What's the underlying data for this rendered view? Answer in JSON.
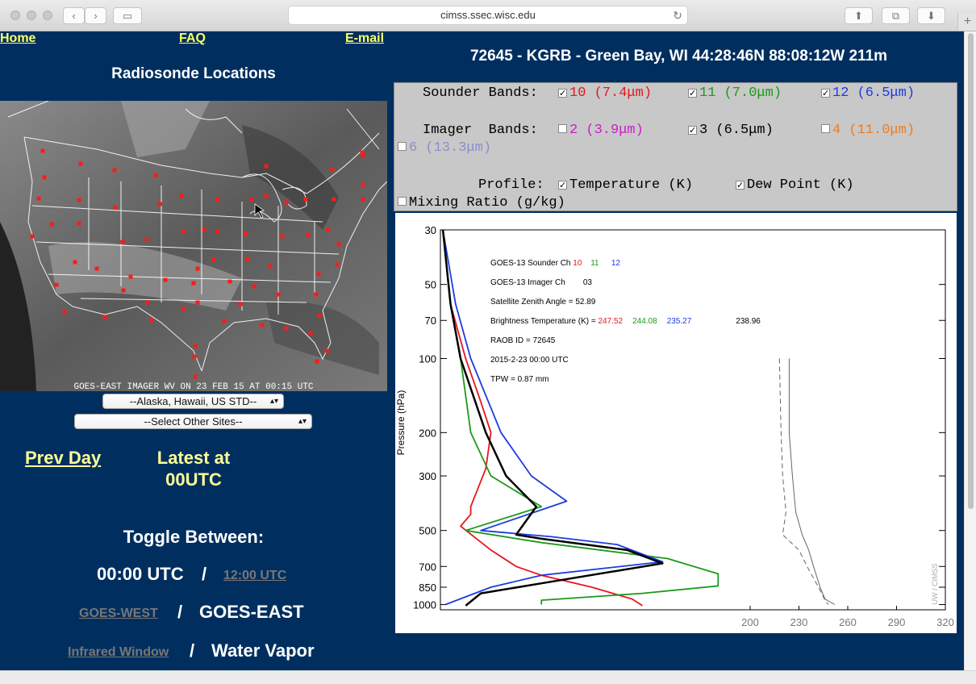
{
  "browser": {
    "url": "cimss.ssec.wisc.edu"
  },
  "nav": {
    "home": "Home",
    "faq": "FAQ",
    "email": "E-mail"
  },
  "left": {
    "title": "Radiosonde Locations",
    "map_caption": "GOES-EAST IMAGER WV ON 23 FEB 15 AT 00:15 UTC",
    "select1": "--Alaska, Hawaii, US STD--",
    "select2": "--Select Other Sites--",
    "prev_day": "Prev Day",
    "latest": "Latest at",
    "latest2": "00UTC",
    "toggle": "Toggle Between:",
    "utc_active": "00:00 UTC",
    "utc_other": "12:00 UTC",
    "sat_other": "GOES-WEST",
    "sat_active": "GOES-EAST",
    "band_other": "Infrared Window",
    "band_active": "Water Vapor",
    "slash": "/"
  },
  "station": {
    "title": "72645 - KGRB - Green Bay, WI 44:28:46N 88:08:12W 211m"
  },
  "options": {
    "sounder_label": "Sounder Bands:",
    "imager_label": "Imager  Bands:",
    "profile_label": "Profile:",
    "sounder": [
      {
        "num": "10",
        "wl": "(7.4μm)",
        "checked": true,
        "color": "#e8151d"
      },
      {
        "num": "11",
        "wl": "(7.0μm)",
        "checked": true,
        "color": "#1b9a1b"
      },
      {
        "num": "12",
        "wl": "(6.5μm)",
        "checked": true,
        "color": "#1c3ce0"
      }
    ],
    "imager": [
      {
        "num": "2",
        "wl": "(3.9μm)",
        "checked": false,
        "color": "#c81ec8"
      },
      {
        "num": "3",
        "wl": "(6.5μm)",
        "checked": true,
        "color": "#000000"
      },
      {
        "num": "4",
        "wl": "(11.0μm)",
        "checked": false,
        "color": "#f07b1e"
      },
      {
        "num": "6",
        "wl": "(13.3μm)",
        "checked": false,
        "color": "#8a8fc8"
      }
    ],
    "profiles": [
      {
        "label": "Temperature (K)",
        "checked": true
      },
      {
        "label": "Dew Point (K)",
        "checked": true
      },
      {
        "label": "Mixing Ratio (g/kg)",
        "checked": false
      }
    ]
  },
  "plot": {
    "info": {
      "line1_prefix": "GOES-13 Sounder Ch",
      "ch10": "10",
      "ch11": "11",
      "ch12": "12",
      "line2_prefix": "GOES-13 Imager  Ch",
      "ch03": "03",
      "zenith": "Satellite Zenith Angle = 52.89",
      "bt_prefix": "Brightness Temperature (K) =",
      "bt10": "247.52",
      "bt11": "244.08",
      "bt12": "235.27",
      "bt03": "238.96",
      "raob": "RAOB ID = 72645",
      "date": "2015-2-23 00:00 UTC",
      "tpw": "TPW = 0.87 mm"
    },
    "watermark": "UW / CIMSS"
  },
  "chart_data": {
    "type": "line",
    "ylabel": "Pressure (hPa)",
    "y_ticks": [
      30,
      50,
      70,
      100,
      200,
      300,
      500,
      700,
      850,
      1000
    ],
    "x_ticks": [
      200,
      230,
      260,
      290,
      320
    ],
    "y_scale": "log",
    "ylim": [
      30,
      1050
    ],
    "xlim": [
      200,
      320
    ],
    "series": [
      {
        "name": "10",
        "color": "#e8151d",
        "kind": "weighting",
        "points": [
          [
            0.005,
            30
          ],
          [
            0.02,
            60
          ],
          [
            0.05,
            100
          ],
          [
            0.08,
            150
          ],
          [
            0.1,
            200
          ],
          [
            0.09,
            280
          ],
          [
            0.06,
            400
          ],
          [
            0.06,
            430
          ],
          [
            0.04,
            480
          ],
          [
            0.1,
            600
          ],
          [
            0.15,
            700
          ],
          [
            0.2,
            760
          ],
          [
            0.3,
            850
          ],
          [
            0.38,
            950
          ],
          [
            0.4,
            1010
          ]
        ]
      },
      {
        "name": "11",
        "color": "#1b9a1b",
        "kind": "weighting",
        "points": [
          [
            0.005,
            30
          ],
          [
            0.02,
            60
          ],
          [
            0.04,
            100
          ],
          [
            0.06,
            200
          ],
          [
            0.1,
            300
          ],
          [
            0.2,
            400
          ],
          [
            0.05,
            500
          ],
          [
            0.2,
            560
          ],
          [
            0.45,
            650
          ],
          [
            0.55,
            750
          ],
          [
            0.55,
            840
          ],
          [
            0.4,
            900
          ],
          [
            0.2,
            960
          ],
          [
            0.2,
            1000
          ]
        ]
      },
      {
        "name": "12",
        "color": "#1c3ce0",
        "kind": "weighting",
        "points": [
          [
            0.005,
            30
          ],
          [
            0.03,
            60
          ],
          [
            0.06,
            100
          ],
          [
            0.12,
            200
          ],
          [
            0.18,
            300
          ],
          [
            0.25,
            380
          ],
          [
            0.08,
            500
          ],
          [
            0.22,
            530
          ],
          [
            0.35,
            570
          ],
          [
            0.44,
            670
          ],
          [
            0.2,
            760
          ],
          [
            0.1,
            850
          ],
          [
            0.01,
            1000
          ]
        ]
      },
      {
        "name": "03",
        "color": "#000000",
        "kind": "weighting",
        "points": [
          [
            0.005,
            30
          ],
          [
            0.02,
            60
          ],
          [
            0.04,
            100
          ],
          [
            0.09,
            200
          ],
          [
            0.13,
            300
          ],
          [
            0.19,
            400
          ],
          [
            0.15,
            520
          ],
          [
            0.2,
            540
          ],
          [
            0.37,
            600
          ],
          [
            0.44,
            680
          ],
          [
            0.2,
            820
          ],
          [
            0.08,
            900
          ],
          [
            0.05,
            1010
          ]
        ]
      }
    ],
    "temperature": [
      [
        224,
        100
      ],
      [
        224,
        200
      ],
      [
        226,
        300
      ],
      [
        228,
        420
      ],
      [
        232,
        520
      ],
      [
        236,
        600
      ],
      [
        239,
        700
      ],
      [
        243,
        850
      ],
      [
        246,
        950
      ],
      [
        252,
        1000
      ]
    ],
    "dewpoint": [
      [
        218,
        100
      ],
      [
        219,
        200
      ],
      [
        220,
        300
      ],
      [
        222,
        420
      ],
      [
        220,
        520
      ],
      [
        230,
        600
      ],
      [
        235,
        700
      ],
      [
        242,
        850
      ],
      [
        246,
        960
      ],
      [
        248,
        1000
      ]
    ]
  }
}
